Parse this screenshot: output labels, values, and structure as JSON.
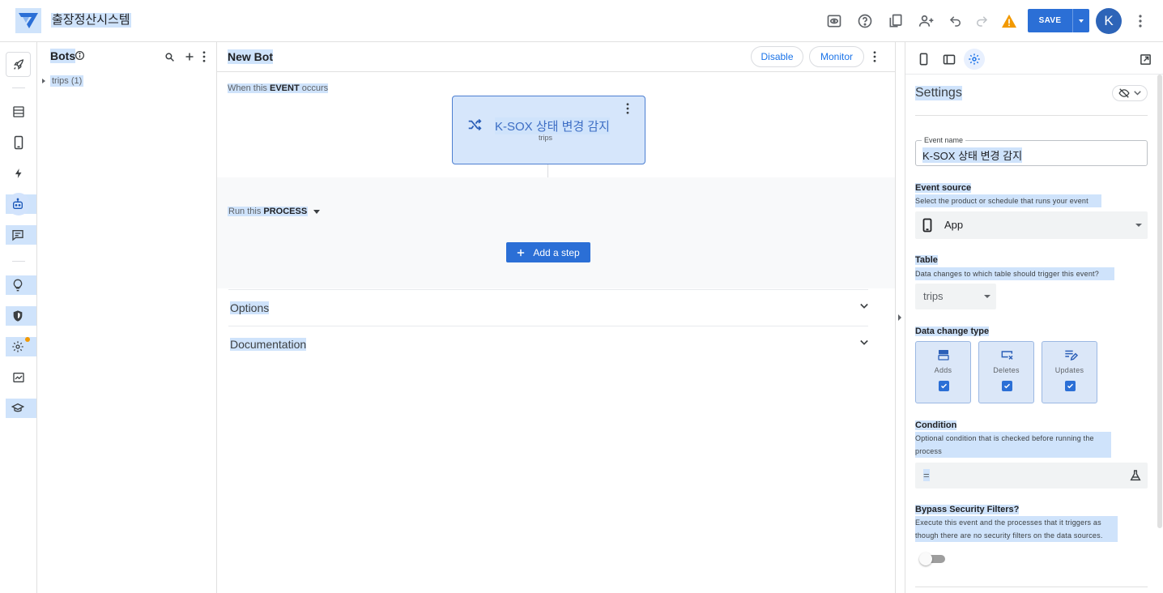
{
  "app": {
    "title": "출장정산시스템"
  },
  "toolbar": {
    "save_label": "SAVE",
    "avatar_letter": "K"
  },
  "bots_panel": {
    "title": "Bots",
    "tree": [
      {
        "label": "trips (1)"
      }
    ]
  },
  "editor": {
    "bot_name": "New Bot",
    "disable_label": "Disable",
    "monitor_label": "Monitor",
    "event_prefix": "When this",
    "event_keyword": "EVENT",
    "event_suffix": "occurs",
    "event_card": {
      "title": "K-SOX 상태 변경 감지",
      "subtitle": "trips"
    },
    "run_prefix": "Run this",
    "run_keyword": "PROCESS",
    "add_step_label": "Add a step",
    "sections": [
      {
        "label": "Options"
      },
      {
        "label": "Documentation"
      }
    ]
  },
  "settings": {
    "title": "Settings",
    "event_name": {
      "legend": "Event name",
      "value": "K-SOX 상태 변경 감지"
    },
    "event_source": {
      "label": "Event source",
      "help": "Select the product or schedule that runs your event",
      "value": "App"
    },
    "table": {
      "label": "Table",
      "help": "Data changes to which table should trigger this event?",
      "value": "trips"
    },
    "change_type": {
      "label": "Data change type",
      "options": [
        {
          "label": "Adds",
          "checked": true
        },
        {
          "label": "Deletes",
          "checked": true
        },
        {
          "label": "Updates",
          "checked": true
        }
      ]
    },
    "condition": {
      "label": "Condition",
      "help": "Optional condition that is checked before running the process",
      "value": "="
    },
    "bypass": {
      "label": "Bypass Security Filters?",
      "help": "Execute this event and the processes that it triggers as though there are no security filters on the data sources.",
      "enabled": false
    }
  },
  "colors": {
    "primary": "#2b6fd6",
    "selection": "#cfe3fb",
    "warning": "#f29900",
    "avatar": "#2d64b8"
  }
}
